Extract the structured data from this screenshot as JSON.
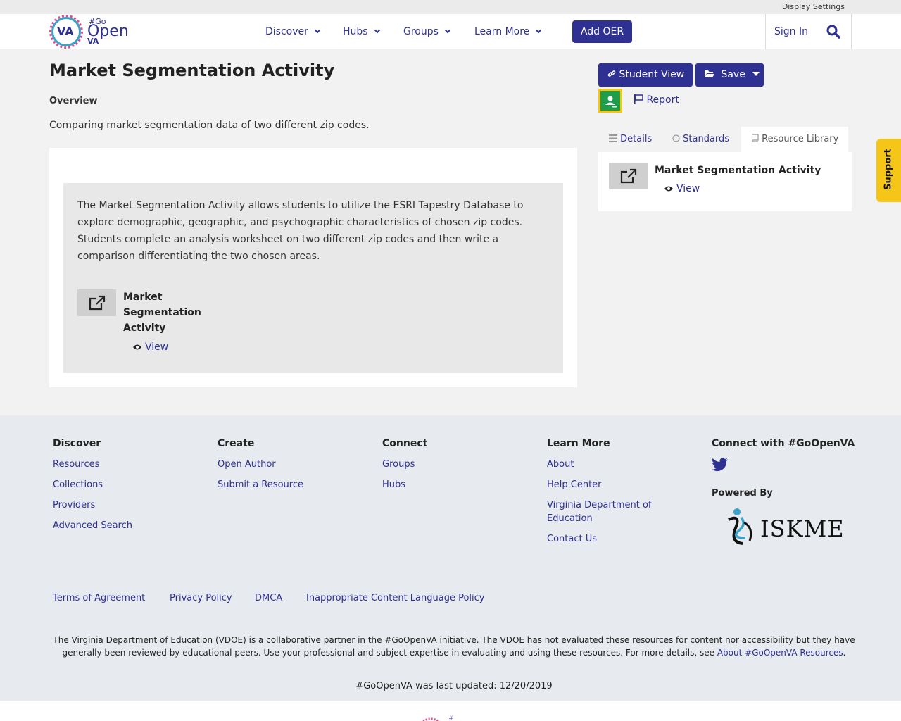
{
  "topbar": {
    "display_settings": "Display Settings"
  },
  "header": {
    "logo": {
      "va": "VA",
      "go": "#Go",
      "open": "Open",
      "va_small": "VA"
    },
    "nav": [
      {
        "label": "Discover"
      },
      {
        "label": "Hubs"
      },
      {
        "label": "Groups"
      },
      {
        "label": "Learn More"
      }
    ],
    "add_oer": "Add OER",
    "sign_in": "Sign In"
  },
  "main": {
    "title": "Market Segmentation Activity",
    "overview_label": "Overview",
    "overview_text": "Comparing market segmentation data of two different zip codes.",
    "description": "The Market Segmentation Activity allows students to utilize the ESRI Tapestry Database to explore demographic, geographic, and psychographic characteristics of chosen zip codes. Students complete an analysis worksheet on two different zip codes and then write a comparison differentiating the two chosen areas.",
    "resource": {
      "title": "Market Segmentation Activity",
      "view": "View"
    }
  },
  "sidebar": {
    "student_view": "Student View",
    "save": "Save",
    "report": "Report",
    "tabs": [
      {
        "label": "Details"
      },
      {
        "label": "Standards"
      },
      {
        "label": "Resource Library"
      }
    ],
    "resource": {
      "title": "Market Segmentation Activity",
      "view": "View"
    }
  },
  "support": "Support",
  "footer": {
    "columns": [
      {
        "heading": "Discover",
        "links": [
          "Resources",
          "Collections",
          "Providers",
          "Advanced Search"
        ]
      },
      {
        "heading": "Create",
        "links": [
          "Open Author",
          "Submit a Resource"
        ]
      },
      {
        "heading": "Connect",
        "links": [
          "Groups",
          "Hubs"
        ]
      },
      {
        "heading": "Learn More",
        "links": [
          "About",
          "Help Center",
          "Virginia Department of Education",
          "Contact Us"
        ]
      }
    ],
    "connect_heading": "Connect with #GoOpenVA",
    "powered_by": "Powered By",
    "iskme": "ISKME",
    "legal": [
      "Terms of Agreement",
      "Privacy Policy",
      "DMCA",
      "Inappropriate Content Language Policy"
    ],
    "disclaimer": "The Virginia Department of Education (VDOE) is a collaborative partner in the #GoOpenVA initiative. The VDOE has not evaluated these resources for content nor accessibility but they have generally been reviewed by educational peers. Use your professional and subject expertise in evaluating and using these resources. For more details, see",
    "disclaimer_link": "About #GoOpenVA Resources",
    "disclaimer_end": ".",
    "last_updated": "#GoOpenVA was last updated: 12/20/2019"
  },
  "colors": {
    "brand": "#2e3192",
    "support": "#f5c518",
    "classroom": "#1e9e4a"
  }
}
